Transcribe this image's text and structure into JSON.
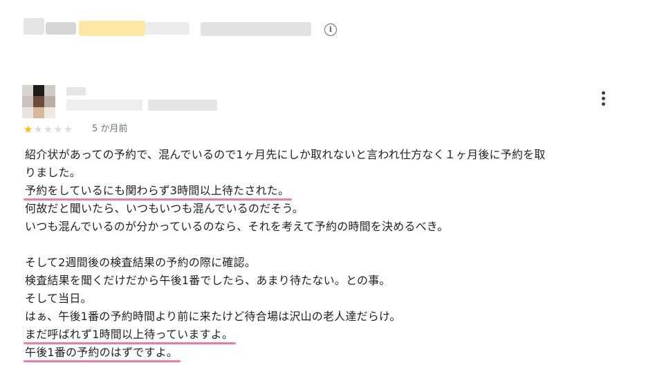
{
  "header": {
    "info_icon": "info-icon"
  },
  "reviewer": {
    "menu_icon": "more-vert-icon"
  },
  "rating": {
    "stars": 1,
    "max": 5,
    "time_ago": "5 か月前",
    "colors": {
      "filled": "#fbbc04",
      "empty": "#dadce0"
    }
  },
  "review": {
    "p1": [
      "紹介状があっての予約で、混んでいるので1ヶ月先にしか取れないと言われ仕方なく１ヶ月後に予約を取",
      "りました。"
    ],
    "hl1": "予約をしているにも関わらず3時間以上待たされた。",
    "p2": [
      "何故だと聞いたら、いつもいつも混んでいるのだそう。",
      "いつも混んでいるのが分かっているのなら、それを考えて予約の時間を決めるべき。"
    ],
    "p3": [
      "そして2週間後の検査結果の予約の際に確認。",
      "検査結果を聞くだけだから午後1番でしたら、あまり待たない。との事。",
      "そして当日。",
      "はぁ、午後1番の予約時間より前に来たけど待合場は沢山の老人達だらけ。"
    ],
    "hl2": "まだ呼ばれず1時間以上待っていますよ。",
    "hl3": "午後1番の予約のはずですよ。",
    "highlight_color": "#f06292"
  }
}
